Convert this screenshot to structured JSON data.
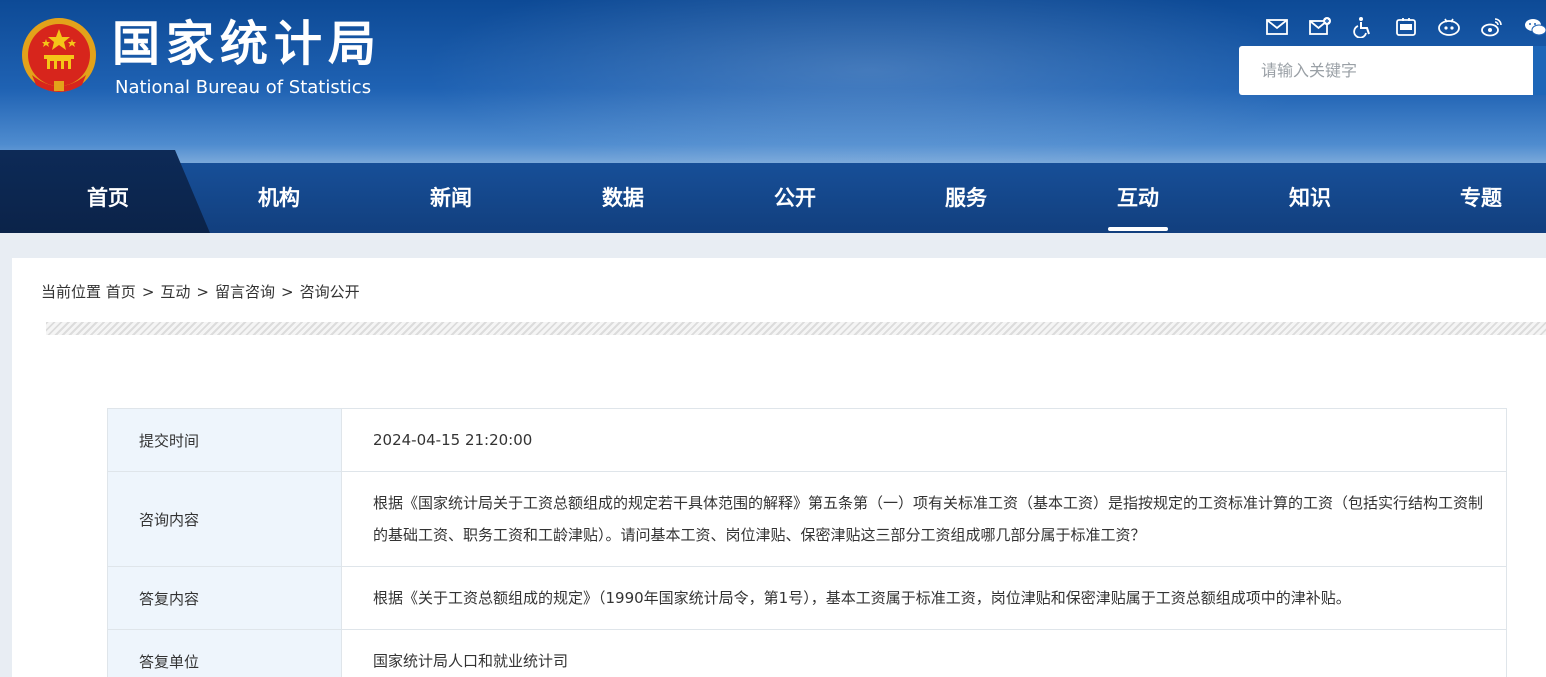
{
  "header": {
    "title_cn": "国家统计局",
    "title_en": "National Bureau of Statistics",
    "icons": [
      "mail-icon",
      "mail-edit-icon",
      "accessibility-icon",
      "app-icon",
      "weibo-icon",
      "weibo-alt-icon",
      "wechat-icon"
    ],
    "search_placeholder": "请输入关键字",
    "colors": {
      "brand_blue": "#1f62b3",
      "nav_dark": "#0d2a57"
    }
  },
  "nav": {
    "items": [
      {
        "label": "首页"
      },
      {
        "label": "机构"
      },
      {
        "label": "新闻"
      },
      {
        "label": "数据"
      },
      {
        "label": "公开"
      },
      {
        "label": "服务"
      },
      {
        "label": "互动"
      },
      {
        "label": "知识"
      },
      {
        "label": "专题"
      }
    ],
    "active": "互动"
  },
  "breadcrumb": {
    "prefix": "当前位置",
    "items": [
      "首页",
      "互动",
      "留言咨询",
      "咨询公开"
    ],
    "separator": ">"
  },
  "detail": {
    "rows": [
      {
        "label": "提交时间",
        "value": "2024-04-15 21:20:00"
      },
      {
        "label": "咨询内容",
        "value": "根据《国家统计局关于工资总额组成的规定若干具体范围的解释》第五条第（一）项有关标准工资（基本工资）是指按规定的工资标准计算的工资（包括实行结构工资制的基础工资、职务工资和工龄津贴）。请问基本工资、岗位津贴、保密津贴这三部分工资组成哪几部分属于标准工资？"
      },
      {
        "label": "答复内容",
        "value": "根据《关于工资总额组成的规定》（1990年国家统计局令，第1号），基本工资属于标准工资，岗位津贴和保密津贴属于工资总额组成项中的津补贴。"
      },
      {
        "label": "答复单位",
        "value": "国家统计局人口和就业统计司"
      }
    ]
  }
}
